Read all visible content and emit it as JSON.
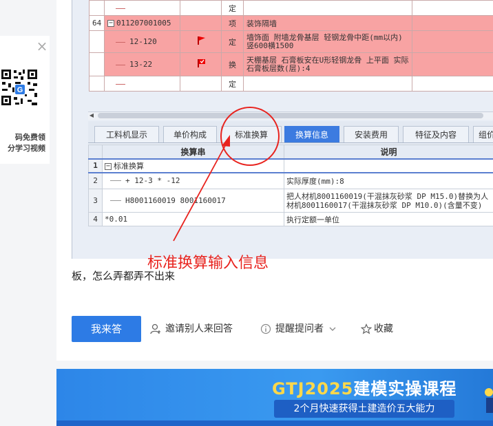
{
  "qr_card": {
    "close_label": "×",
    "text_line1": "码免费领",
    "text_line2": "分学习视频"
  },
  "grid_top": {
    "rows": [
      {
        "num": "",
        "code": "",
        "unit": "定",
        "desc": ""
      },
      {
        "num": "64",
        "code": "011207001005",
        "unit": "项",
        "desc": "装饰隔墙"
      },
      {
        "num": "",
        "code": "12-120",
        "unit": "定",
        "desc": "墙饰面 附墙龙骨基层 轻钢龙骨中距(mm以内)竖600横1500"
      },
      {
        "num": "",
        "code": "13-22",
        "unit": "换",
        "desc": "天棚基层 石膏板安在U形轻钢龙骨 上平面 实际石膏板层数(层):4"
      },
      {
        "num": "",
        "code": "",
        "unit": "定",
        "desc": ""
      }
    ]
  },
  "tabs": [
    {
      "label": "工料机显示"
    },
    {
      "label": "单价构成"
    },
    {
      "label": "标准换算"
    },
    {
      "label": "换算信息"
    },
    {
      "label": "安装费用"
    },
    {
      "label": "特征及内容"
    },
    {
      "label": "组价"
    }
  ],
  "grid_bottom": {
    "headers": [
      "换算串",
      "说明"
    ],
    "rows": [
      {
        "num": "1",
        "expr": "标准换算",
        "desc": ""
      },
      {
        "num": "2",
        "expr": "+ 12-3 * -12",
        "desc": "实际厚度(mm):8"
      },
      {
        "num": "3",
        "expr": "H8001160019 8001160017",
        "desc": "把人材机8001160019(干混抹灰砂浆 DP M15.0)替换为人材机8001160017(干混抹灰砂浆 DP M10.0)(含量不变)"
      },
      {
        "num": "4",
        "expr": "*0.01",
        "desc": "执行定额一单位"
      }
    ]
  },
  "annotation": {
    "text": "标准换算输入信息",
    "color": "#e8231e"
  },
  "question": {
    "text": "板，怎么弄都弄不出来"
  },
  "actions": {
    "answer_label": "我来答",
    "invite_label": "邀请别人来回答",
    "remind_label": "提醒提问者",
    "favorite_label": "收藏"
  },
  "banner": {
    "title_yellow": "GTJ2025",
    "title_white": "建模实操课程",
    "subtitle": "2个月快速获得土建造价五大能力"
  },
  "colors": {
    "accent": "#2d7be5",
    "row_red": "#f8a3a3",
    "annotation": "#e8231e"
  }
}
